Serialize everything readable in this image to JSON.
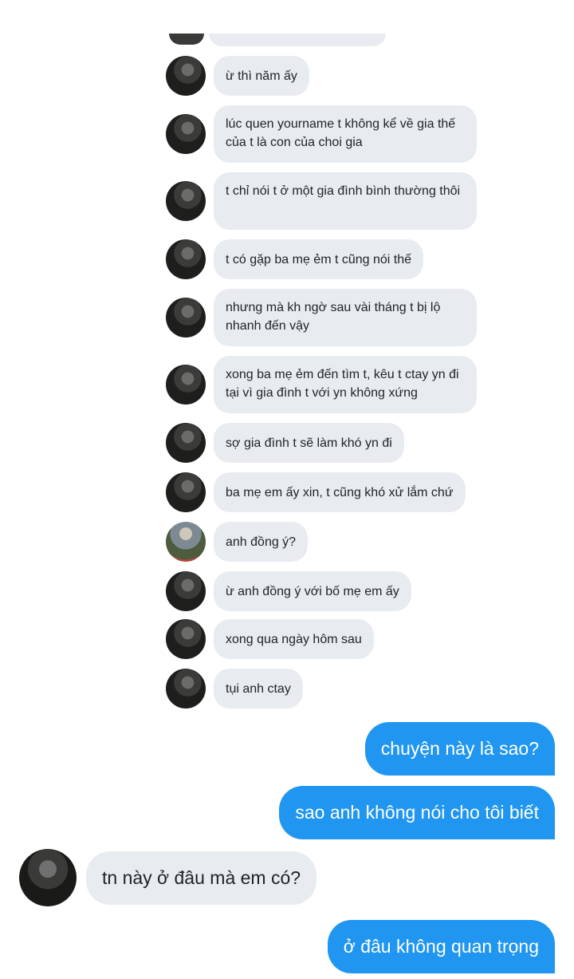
{
  "quoted_messages": [
    {
      "avatar": "person-at-table-avatar",
      "text": "ừ thì năm ấy"
    },
    {
      "avatar": "person-at-table-avatar",
      "text": "lúc quen yourname t không kể về gia thế của t là con của choi gia"
    },
    {
      "avatar": "person-at-table-avatar",
      "text": "t chỉ nói t ở một gia đình bình thường thôi"
    },
    {
      "avatar": "person-at-table-avatar",
      "text": "t có gặp ba mẹ ẻm t cũng nói thế"
    },
    {
      "avatar": "person-at-table-avatar",
      "text": "nhưng mà kh ngờ sau vài tháng t bị lộ nhanh đến vậy"
    },
    {
      "avatar": "person-at-table-avatar",
      "text": "xong ba mẹ ẻm đến tìm t, kêu t ctay yn đi tại vì gia đình t với yn không xứng"
    },
    {
      "avatar": "person-at-table-avatar",
      "text": "sợ gia đình t sẽ làm khó yn đi"
    },
    {
      "avatar": "person-at-table-avatar",
      "text": "ba mẹ em ấy xin, t cũng khó xử lắm chứ"
    },
    {
      "avatar": "person-outdoor-avatar",
      "text": "anh đồng ý?"
    },
    {
      "avatar": "person-at-table-avatar",
      "text": "ừ anh đồng ý với bố mẹ em ấy"
    },
    {
      "avatar": "person-at-table-avatar",
      "text": "xong qua ngày hôm sau"
    },
    {
      "avatar": "person-at-table-avatar",
      "text": "tụi anh ctay"
    }
  ],
  "conversation": {
    "outgoing_1": "chuyện này là sao?",
    "outgoing_2": "sao anh không nói cho tôi biết",
    "incoming_1": "tn này ở đâu mà em có?",
    "outgoing_3": "ở đâu không quan trọng"
  },
  "colors": {
    "outgoing_bubble": "#2196f0",
    "incoming_bubble": "#e8ecf0",
    "background": "#ffffff"
  }
}
